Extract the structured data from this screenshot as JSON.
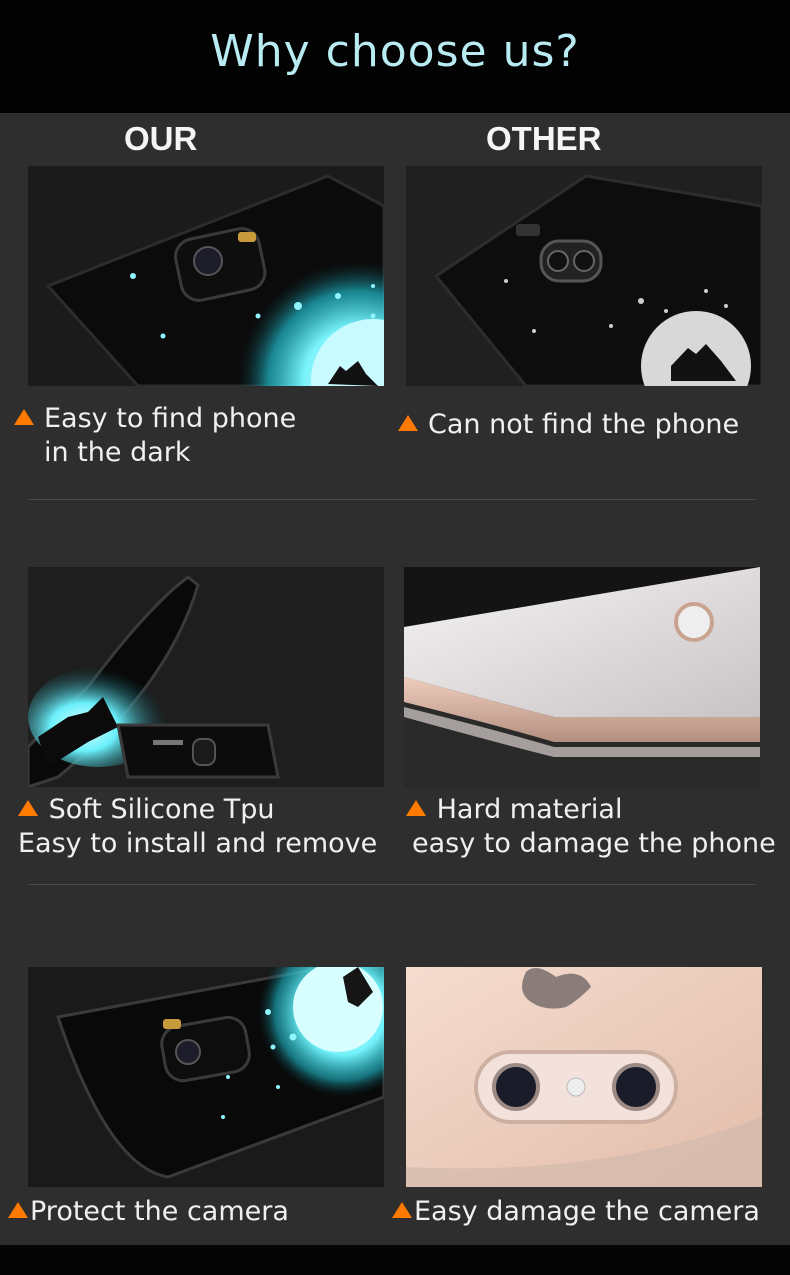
{
  "header": {
    "title": "Why choose us?"
  },
  "columns": {
    "ours": "OUR",
    "other": "OTHER"
  },
  "rows": [
    {
      "ours": {
        "line1": "Easy to find phone",
        "line2": "in the dark"
      },
      "other": {
        "line1": "Can not find the phone",
        "line2": ""
      }
    },
    {
      "ours": {
        "line1": "Soft Silicone Tpu",
        "line2": "Easy to install and remove"
      },
      "other": {
        "line1": "Hard material",
        "line2": "easy to damage the phone"
      }
    },
    {
      "ours": {
        "line1": "Protect the camera",
        "line2": ""
      },
      "other": {
        "line1": "Easy damage the camera",
        "line2": ""
      }
    }
  ],
  "colors": {
    "accent": "#ff7a00",
    "glow": "#39e3f0",
    "title": "#b8ecf2"
  }
}
